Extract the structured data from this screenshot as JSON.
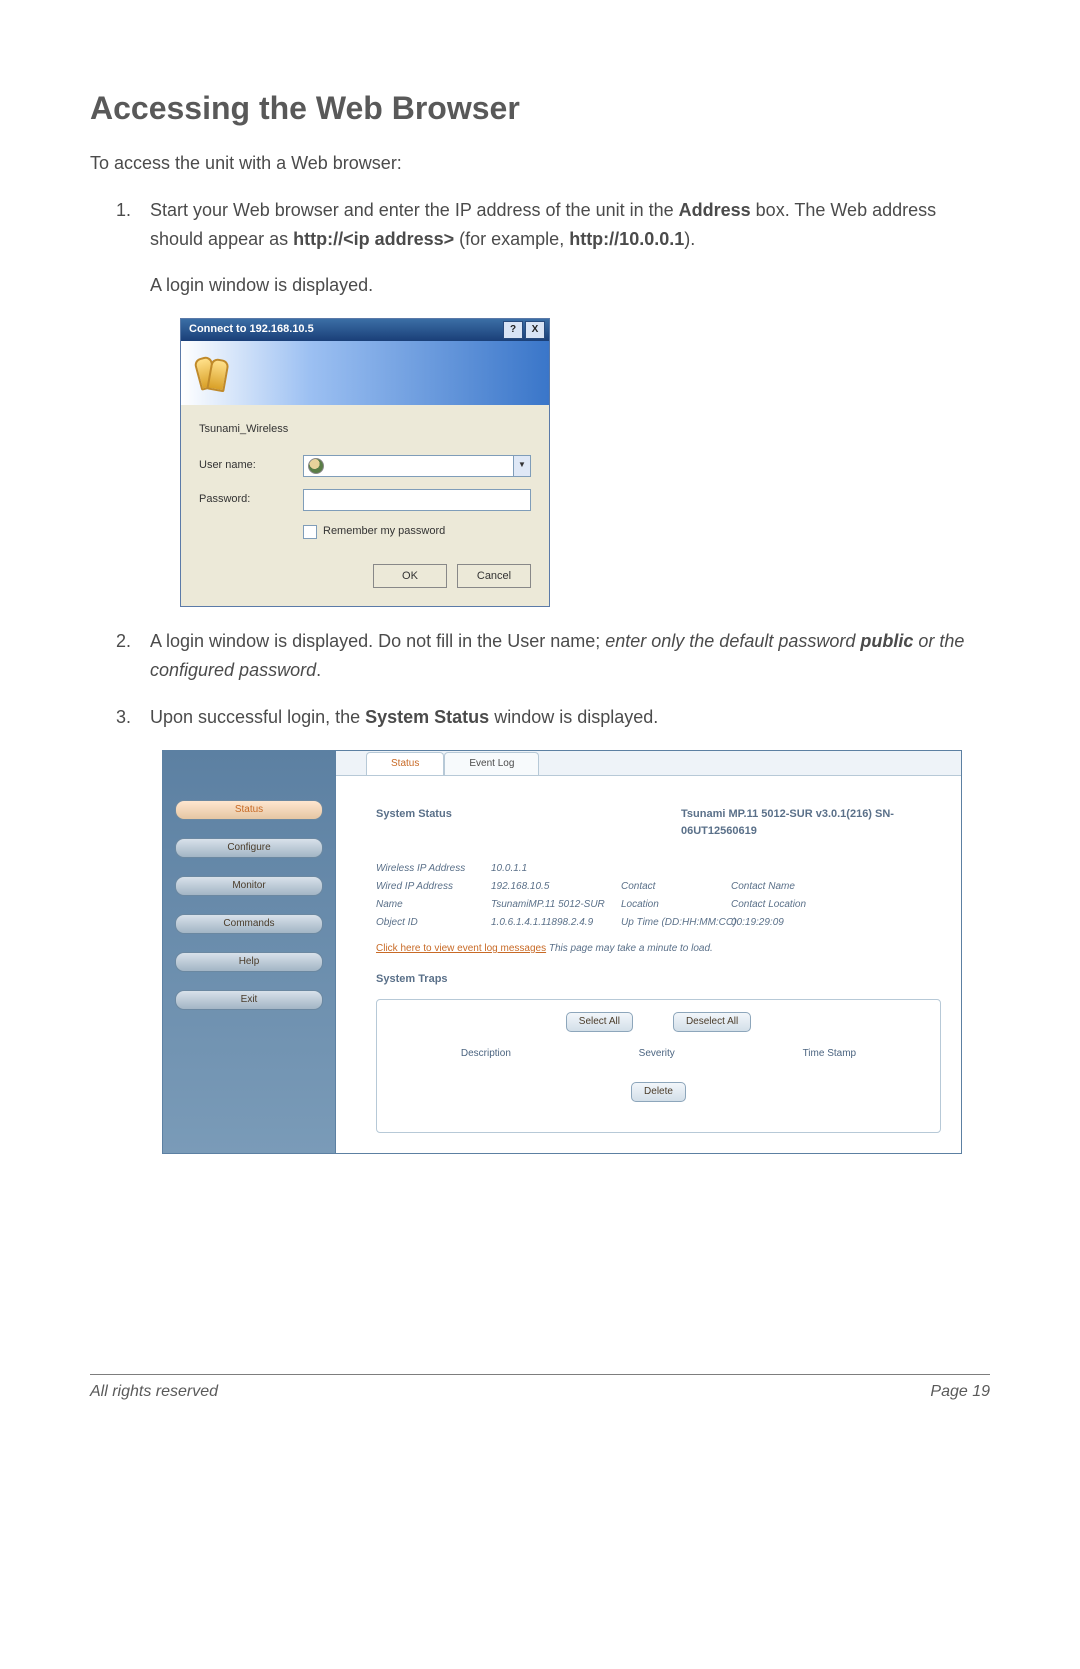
{
  "page": {
    "title": "Accessing the Web Browser",
    "intro": "To access the unit with a Web browser:",
    "step1_pre": "Start your Web browser and enter the IP address of the unit in the ",
    "step1_b1": "Address",
    "step1_mid": " box.  The Web address should appear as ",
    "step1_b2": "http://<ip address>",
    "step1_post": " (for example, ",
    "step1_b3": "http://10.0.0.1",
    "step1_end": ").",
    "step1_p2": "A login window is displayed.",
    "step2_pre": "A login window is displayed.  Do not fill in the User name; ",
    "step2_i1": "enter only the default password ",
    "step2_bi": "public",
    "step2_i2": " or the configured password",
    "step2_end": ".",
    "step3_pre": "Upon successful login, the ",
    "step3_b": "System Status",
    "step3_post": " window is displayed."
  },
  "login": {
    "title": "Connect to 192.168.10.5",
    "help": "?",
    "close": "X",
    "realm": "Tsunami_Wireless",
    "user_label": "User name:",
    "pass_label": "Password:",
    "remember": "Remember my password",
    "ok": "OK",
    "cancel": "Cancel"
  },
  "sys": {
    "sidebar": [
      "Status",
      "Configure",
      "Monitor",
      "Commands",
      "Help",
      "Exit"
    ],
    "tabs": [
      "Status",
      "Event Log"
    ],
    "heading": "System Status",
    "device": "Tsunami MP.11 5012-SUR v3.0.1(216) SN-06UT12560619",
    "info": {
      "r1c1": "Wireless IP Address",
      "r1c2": "10.0.1.1",
      "r1c3": "",
      "r1c4": "",
      "r2c1": "Wired IP Address",
      "r2c2": "192.168.10.5",
      "r2c3": "Contact",
      "r2c4": "Contact Name",
      "r3c1": "Name",
      "r3c2": "TsunamiMP.11 5012-SUR",
      "r3c3": "Location",
      "r3c4": "Contact Location",
      "r4c1": "Object ID",
      "r4c2": "1.0.6.1.4.1.11898.2.4.9",
      "r4c3": "Up Time (DD:HH:MM:CC)",
      "r4c4": "00:19:29:09"
    },
    "link_text": "Click here to view event log messages",
    "link_note": " This page may take a minute to load.",
    "traps_heading": "System Traps",
    "select_all": "Select All",
    "deselect_all": "Deselect All",
    "col_desc": "Description",
    "col_sev": "Severity",
    "col_time": "Time Stamp",
    "delete": "Delete"
  },
  "footer": {
    "left": "All rights reserved",
    "right": "Page 19"
  }
}
